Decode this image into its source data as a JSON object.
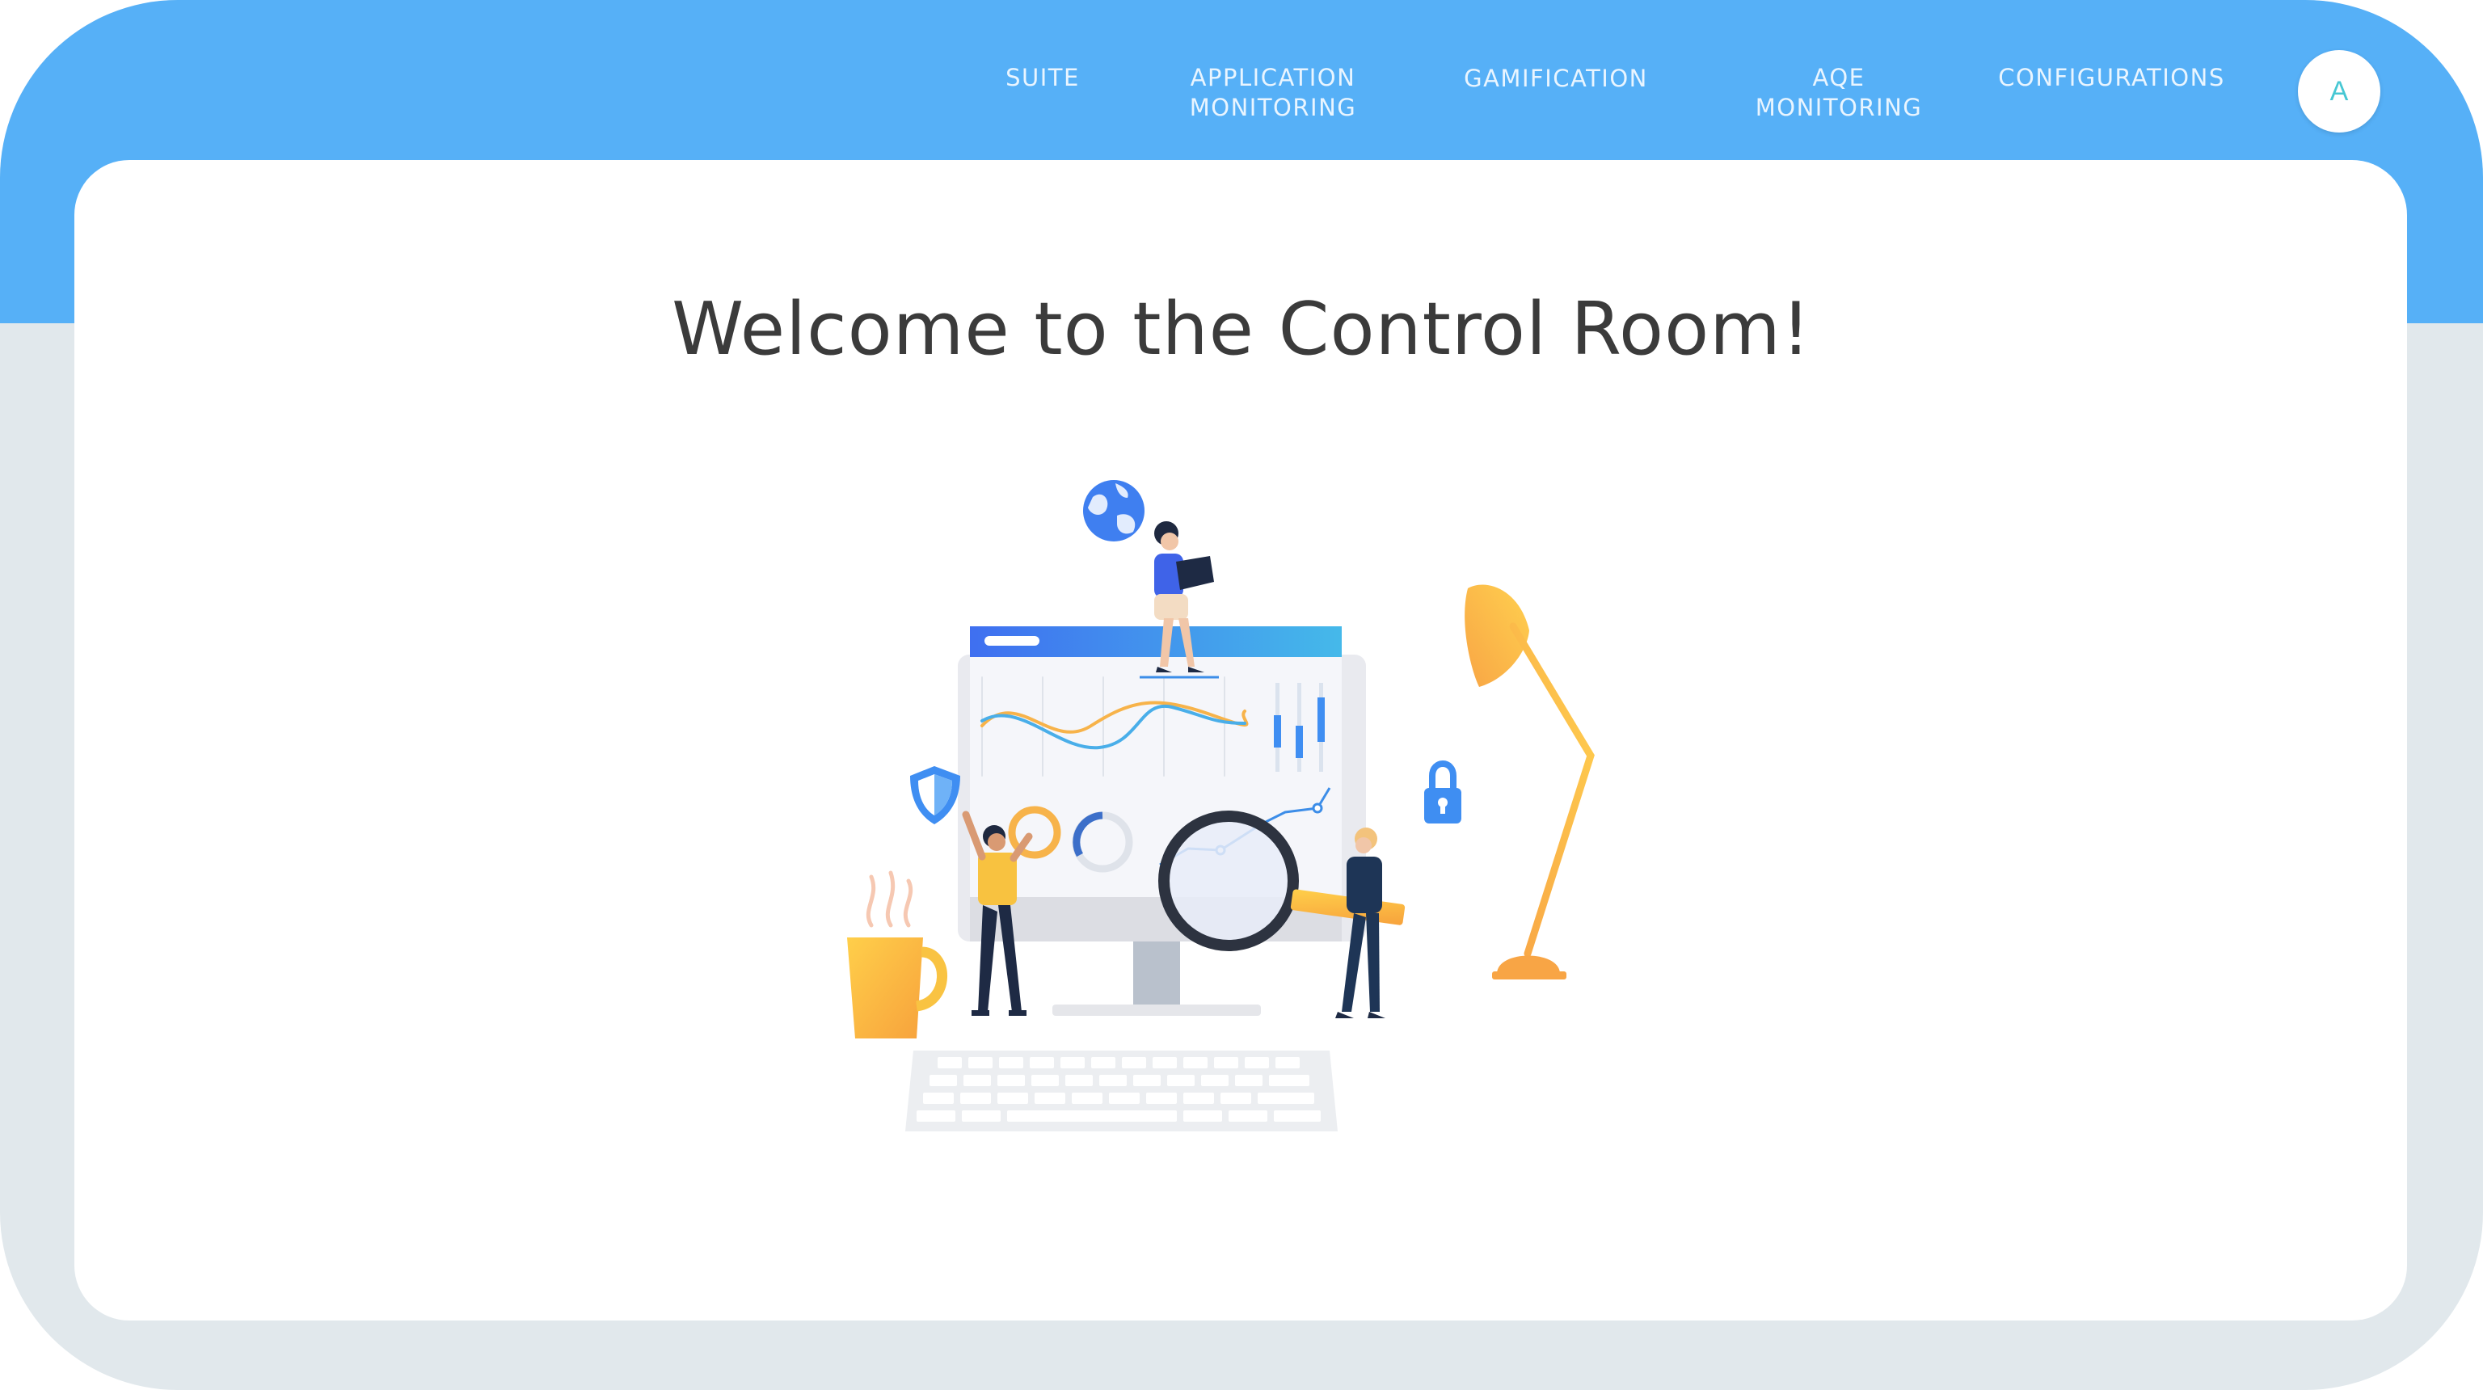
{
  "nav": {
    "items": [
      {
        "id": "suite",
        "label_lines": [
          "SUITE"
        ]
      },
      {
        "id": "application-monitoring",
        "label_lines": [
          "APPLICATION",
          "MONITORING"
        ]
      },
      {
        "id": "gamification",
        "label_lines": [
          "GAMIFICATION"
        ]
      },
      {
        "id": "aqe-monitoring",
        "label_lines": [
          "AQE",
          "MONITORING"
        ]
      },
      {
        "id": "configurations",
        "label_lines": [
          "CONFIGURATIONS"
        ]
      }
    ],
    "avatar_initial": "A"
  },
  "main": {
    "title": "Welcome to the Control Room!"
  },
  "colors": {
    "header": "#56b0f7",
    "background": "#e1e8ec",
    "card": "#ffffff",
    "accent_blue": "#3f8ef2",
    "accent_orange": "#f8b13e",
    "avatar_text": "#46c7d3"
  },
  "illustration": {
    "icons": [
      "globe-icon",
      "shield-icon",
      "lock-icon",
      "magnifier-icon",
      "coffee-cup-icon",
      "desk-lamp-icon",
      "keyboard-icon",
      "monitor-icon"
    ]
  }
}
